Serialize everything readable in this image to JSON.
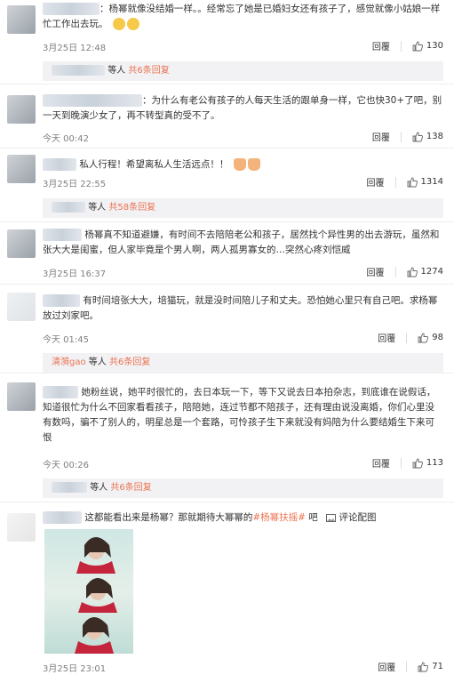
{
  "comments": [
    {
      "text": "：杨幂就像没结婚一样。。经常忘了她是已婚妇女还有孩子了，感觉就像小姑娘一样忙工作出去玩。",
      "time": "3月25日 12:48",
      "reply_label": "回覆",
      "likes": "130",
      "reply_summary": {
        "prefix": "等人",
        "count": "共6条回复"
      }
    },
    {
      "text": "：为什么有老公有孩子的人每天生活的跟单身一样，它也快30+了吧，别一天到晚演少女了，再不转型真的受不了。",
      "time": "今天 00:42",
      "reply_label": "回覆",
      "likes": "138"
    },
    {
      "text": "私人行程！希望离私人生活远点！！",
      "time": "3月25日 22:55",
      "reply_label": "回覆",
      "likes": "1314",
      "reply_summary": {
        "prefix": "等人",
        "count": "共58条回复"
      }
    },
    {
      "text": "杨幂真不知道避嫌，有时间不去陪陪老公和孩子，居然找个异性男的出去游玩，虽然和张大大是闺蜜，但人家毕竟是个男人啊，两人孤男寡女的…突然心疼刘恺威",
      "time": "3月25日 16:37",
      "reply_label": "回覆",
      "likes": "1274"
    },
    {
      "text": "有时间培张大大，培猫玩，就是没时间陪儿子和丈夫。恐怕她心里只有自己吧。求杨幂放过刘家吧。",
      "time": "今天 01:45",
      "reply_label": "回覆",
      "likes": "98",
      "reply_summary": {
        "name": "清漪gao",
        "prefix": "等人",
        "count": "共6条回复"
      }
    },
    {
      "text": "她粉丝说，她平时很忙的，去日本玩一下，等下又说去日本拍杂志，到底谁在说假话，知道很忙为什么不回家看看孩子，陪陪她，连过节都不陪孩子，还有理由说没离婚，你们心里没有数吗，骗不了别人的，明星总是一个套路，可怜孩子生下来就没有妈陪为什么要结婚生下来可恨",
      "time": "今天 00:26",
      "reply_label": "回覆",
      "likes": "113",
      "reply_summary": {
        "prefix": "等人",
        "count": "共6条回复"
      }
    },
    {
      "text_before": "这都能看出来是杨幂？那就期待大幂幂的",
      "hashtag": "#杨幂扶摇#",
      "text_after": " 吧",
      "pic_label": "评论配图",
      "time": "3月25日 23:01",
      "reply_label": "回覆",
      "likes": "71"
    }
  ],
  "colors": {
    "accent": "#eb7350",
    "meta": "#808080",
    "reply_bg": "#f2f2f5"
  }
}
